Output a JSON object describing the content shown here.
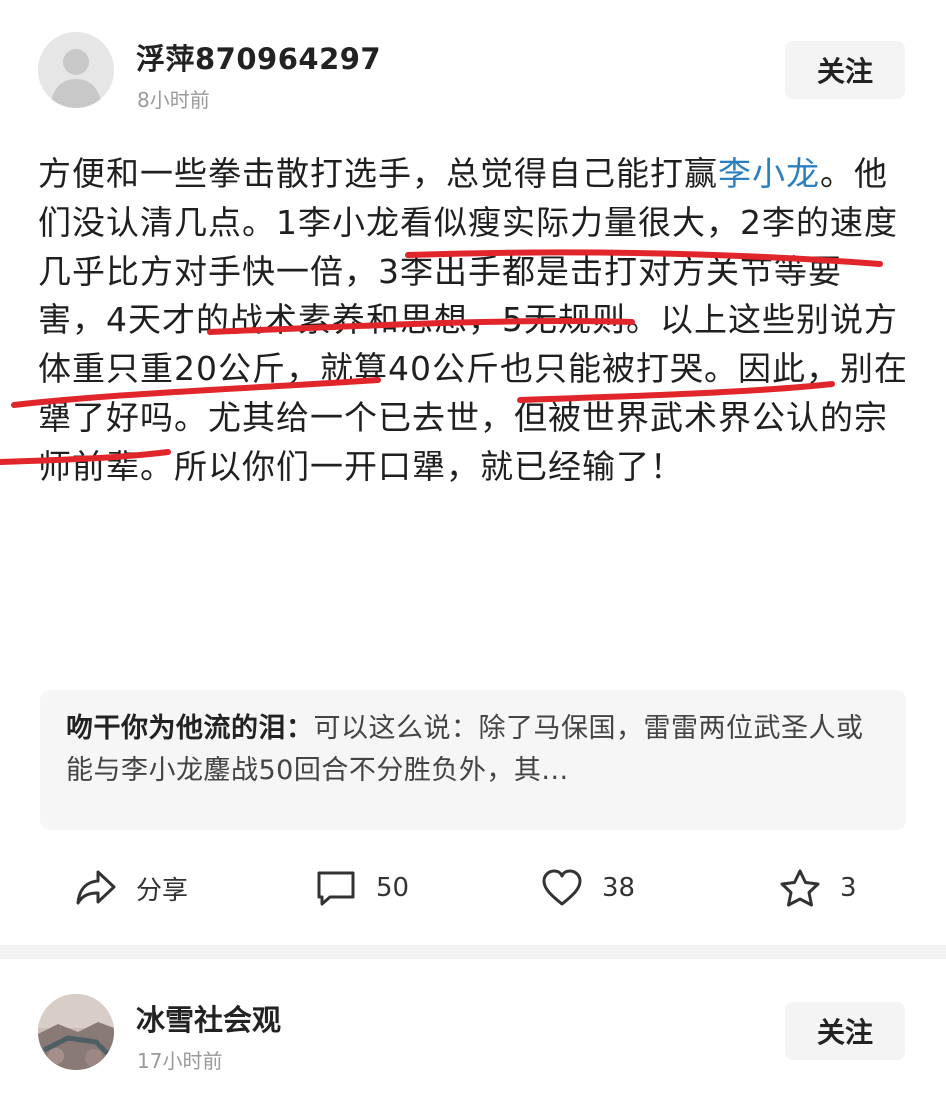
{
  "post": {
    "username": "浮萍870964297",
    "time": "8小时前",
    "follow_label": "关注",
    "content_parts": {
      "p1": "方便和一些拳击散打选手，总觉得自己能打赢",
      "link": "李小龙",
      "p2": "。他们没认清几点。1李小龙看似瘦实际力量很大，2李的速度几乎比方对手快一倍，3李出手都是击打对方关节等要害，4天才的战术素养和思想，5无规则。以上这些别说方体重只重20公斤，就算40公斤也只能被打哭。因此，别在犟了好吗。尤其给一个已去世，但被世界武术界公认的宗师前辈。所以你们一开口犟，就已经输了！"
    },
    "comment": {
      "author": "吻干你为他流的泪：",
      "text": "可以这么说：除了马保国，雷雷两位武圣人或能与李小龙鏖战50回合不分胜负外，其..."
    },
    "actions": {
      "share_label": "分享",
      "comments_count": "50",
      "likes_count": "38",
      "favorites_count": "3"
    },
    "underline_color": "#e0262b",
    "link_color": "#2a7fc1"
  },
  "post2": {
    "username": "冰雪社会观",
    "time": "17小时前",
    "follow_label": "关注"
  }
}
